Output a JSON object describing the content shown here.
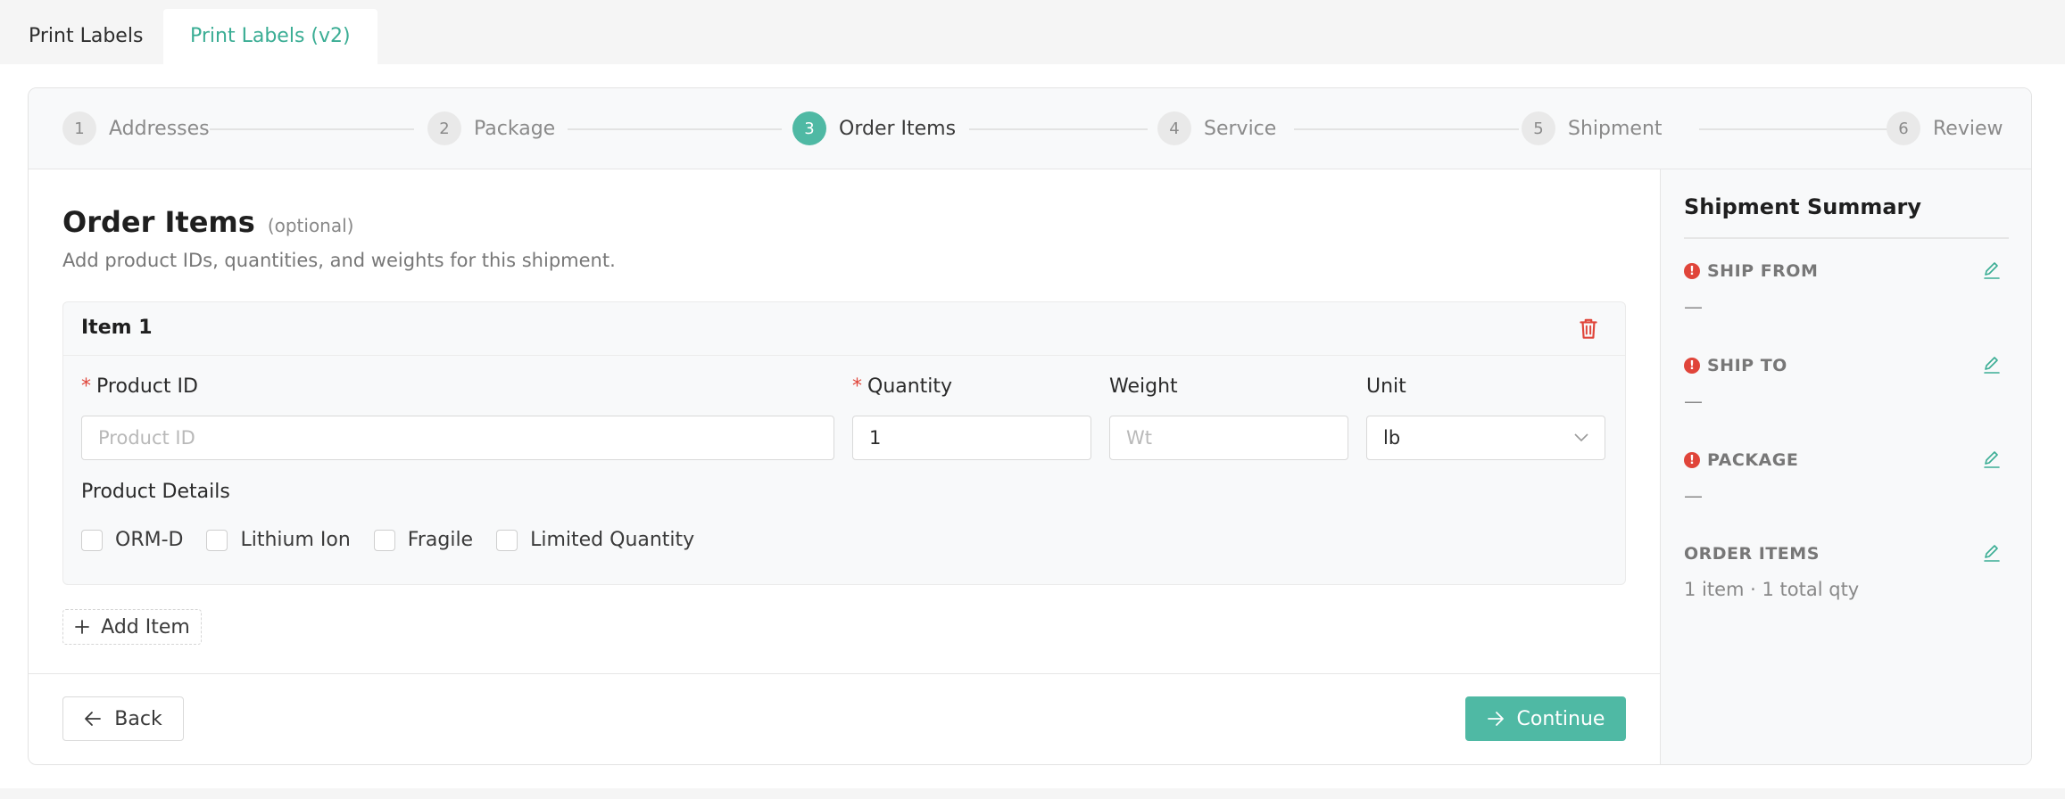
{
  "tabs": [
    {
      "label": "Print Labels"
    },
    {
      "label": "Print Labels (v2)"
    }
  ],
  "stepper": {
    "steps": [
      {
        "num": "1",
        "label": "Addresses"
      },
      {
        "num": "2",
        "label": "Package"
      },
      {
        "num": "3",
        "label": "Order Items"
      },
      {
        "num": "4",
        "label": "Service"
      },
      {
        "num": "5",
        "label": "Shipment"
      },
      {
        "num": "6",
        "label": "Review"
      }
    ],
    "active_step": 3
  },
  "main": {
    "title": "Order Items",
    "optional": "(optional)",
    "subtitle": "Add product IDs, quantities, and weights for this shipment.",
    "item": {
      "title": "Item 1",
      "product_id_label": "Product ID",
      "product_id_value": "",
      "product_id_placeholder": "Product ID",
      "quantity_label": "Quantity",
      "quantity_value": "1",
      "weight_label": "Weight",
      "weight_value": "",
      "weight_placeholder": "Wt",
      "unit_label": "Unit",
      "unit_value": "lb",
      "details_label": "Product Details",
      "checkboxes": [
        {
          "label": "ORM-D",
          "checked": false
        },
        {
          "label": "Lithium Ion",
          "checked": false
        },
        {
          "label": "Fragile",
          "checked": false
        },
        {
          "label": "Limited Quantity",
          "checked": false
        }
      ],
      "required_mark": "*"
    },
    "add_item_label": "Add Item",
    "back_label": "Back",
    "continue_label": "Continue"
  },
  "sidebar": {
    "title": "Shipment Summary",
    "warn_glyph": "!",
    "sections": [
      {
        "label": "SHIP FROM",
        "value": "—",
        "warning": true
      },
      {
        "label": "SHIP TO",
        "value": "—",
        "warning": true
      },
      {
        "label": "PACKAGE",
        "value": "—",
        "warning": true
      },
      {
        "label": "ORDER ITEMS",
        "value": "1 item · 1 total qty",
        "warning": false
      }
    ]
  },
  "colors": {
    "accent": "#4fb9a4",
    "accent_text": "#3aad94",
    "danger": "#e0453a",
    "page_bg": "#f5f5f5"
  },
  "icons": {
    "trash": "trash-icon",
    "edit": "pencil-icon",
    "add": "plus-icon",
    "back": "arrow-left-icon",
    "continue": "arrow-right-icon",
    "select": "chevron-down-icon",
    "warning": "alert-circle-icon"
  }
}
